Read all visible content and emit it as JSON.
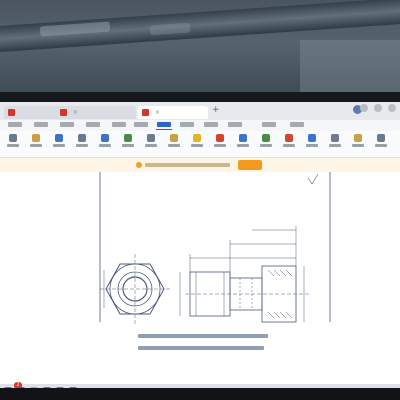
{
  "app": {
    "name": "",
    "tabs": [
      {
        "title": "",
        "icon": "pdf-icon",
        "active": false
      },
      {
        "title": "",
        "icon": "pdf-icon",
        "active": false
      },
      {
        "title": "",
        "icon": "pdf-icon",
        "active": true
      }
    ],
    "new_tab_glyph": "+"
  },
  "menubar": {
    "items": [
      "",
      "",
      "",
      "",
      "",
      "",
      "",
      "",
      "",
      "",
      "",
      ""
    ],
    "active_index": 6
  },
  "ribbon": {
    "tools": [
      {
        "label": "",
        "icon": "undo-icon",
        "color": "#6a7a90"
      },
      {
        "label": "",
        "icon": "open-icon",
        "color": "#c8a242"
      },
      {
        "label": "",
        "icon": "save-icon",
        "color": "#3b73c8"
      },
      {
        "label": "",
        "icon": "print-icon",
        "color": "#6a7a90"
      },
      {
        "label": "",
        "icon": "zoom-icon",
        "color": "#3b73c8"
      },
      {
        "label": "",
        "icon": "rotate-icon",
        "color": "#4a8b4a"
      },
      {
        "label": "",
        "icon": "select-icon",
        "color": "#6a7a90"
      },
      {
        "label": "",
        "icon": "hand-icon",
        "color": "#c8a242"
      },
      {
        "label": "",
        "icon": "highlight-icon",
        "color": "#e4b228"
      },
      {
        "label": "",
        "icon": "annotate-icon",
        "color": "#d2452e"
      },
      {
        "label": "",
        "icon": "text-icon",
        "color": "#3b73c8"
      },
      {
        "label": "",
        "icon": "image-icon",
        "color": "#4a8b4a"
      },
      {
        "label": "",
        "icon": "convert-icon",
        "color": "#d2452e"
      },
      {
        "label": "",
        "icon": "compress-icon",
        "color": "#3b73c8"
      },
      {
        "label": "",
        "icon": "translate-icon",
        "color": "#6a7a90"
      },
      {
        "label": "",
        "icon": "sign-icon",
        "color": "#c8a242"
      },
      {
        "label": "",
        "icon": "settings-icon",
        "color": "#6a7a90"
      }
    ]
  },
  "notice": {
    "text": "",
    "button": ""
  },
  "document": {
    "caption_lines": [
      "",
      ""
    ]
  },
  "taskbar": {
    "badge_count": "2",
    "icons": [
      {
        "icon": "windows-start-icon",
        "color": "#3a7bd5"
      },
      {
        "icon": "app-icon",
        "color": "#d23a2f"
      },
      {
        "icon": "app-icon",
        "color": "#e0a030"
      },
      {
        "icon": "app-icon",
        "color": "#3a7bd5"
      },
      {
        "icon": "app-icon",
        "color": "#4a9a4a"
      },
      {
        "icon": "app-icon",
        "color": "#9050c0"
      }
    ]
  },
  "colors": {
    "accent": "#2a64c9",
    "pdf_red": "#d8352a",
    "notice_button": "#f39a1e"
  }
}
